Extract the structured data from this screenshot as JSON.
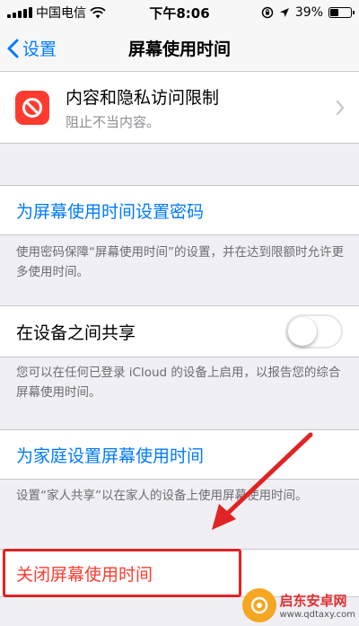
{
  "status_bar": {
    "carrier": "中国电信",
    "time": "下午8:06",
    "battery": "39%",
    "battery_level": 0.39
  },
  "nav": {
    "back_label": "设置",
    "title": "屏幕使用时间"
  },
  "content_privacy": {
    "title": "内容和隐私访问限制",
    "subtitle": "阻止不当内容。"
  },
  "passcode": {
    "label": "为屏幕使用时间设置密码",
    "footnote": "使用密码保障“屏幕使用时间”的设置，并在达到限额时允许更多使用时间。"
  },
  "share": {
    "label": "在设备之间共享",
    "toggle_on": false,
    "footnote": "您可以在任何已登录 iCloud 的设备上启用，以报告您的综合屏幕使用时间。"
  },
  "family": {
    "label": "为家庭设置屏幕使用时间",
    "footnote": "设置“家人共享”以在家人的设备上使用屏幕使用时间。"
  },
  "turn_off": {
    "label": "关闭屏幕使用时间"
  },
  "watermark": {
    "name": "启东安卓网",
    "url": "www.qdtaxy.com"
  },
  "colors": {
    "ios_blue": "#007aff",
    "ios_red": "#ff3b30",
    "annotation_red": "#e02424",
    "background": "#efeff4"
  }
}
